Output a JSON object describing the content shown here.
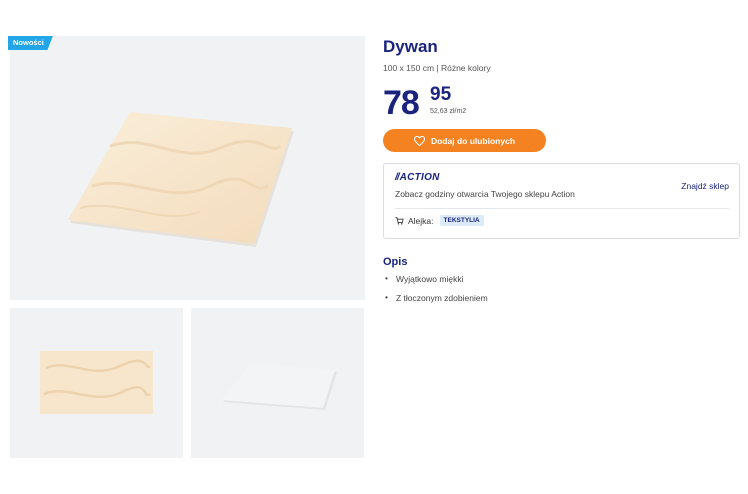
{
  "badge": "Nowości",
  "product": {
    "title": "Dywan",
    "subtitle": "100 x 150 cm | Różne kolory",
    "price_main": "78",
    "price_cents": "95",
    "price_per_unit": "52,63 zł/m2"
  },
  "favorite_button": {
    "label": "Dodaj do ulubionych",
    "icon": "heart-icon"
  },
  "store": {
    "brand": "ACTION",
    "hours_text": "Zobacz godziny otwarcia Twojego sklepu Action",
    "find_store_label": "Znajdź sklep",
    "aisle_label": "Alejka:",
    "aisle_value": "TEKSTYLIA",
    "aisle_icon": "cart-icon"
  },
  "description": {
    "title": "Opis",
    "items": [
      "Wyjątkowo miękki",
      "Z tłoczonym zdobieniem"
    ]
  },
  "colors": {
    "brand_blue": "#1a237e",
    "accent_orange": "#f58220",
    "badge_blue": "#23a6e8",
    "image_bg": "#f0f2f4",
    "rug_beige": "#f7e6cc",
    "rug_white": "#eceef0"
  }
}
